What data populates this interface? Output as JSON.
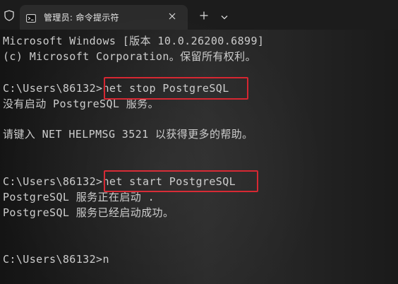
{
  "window": {
    "tab_title": "管理员: 命令提示符",
    "tab_icon": "cmd-prompt-icon",
    "shield_icon": "shield-icon",
    "close_icon": "close-icon",
    "new_tab_icon": "plus-icon",
    "dropdown_icon": "chevron-down-icon"
  },
  "colors": {
    "terminal_text": "#cccccc",
    "highlight_box": "#d6232e",
    "tab_background": "#2b2b2b",
    "titlebar_background": "#1c1c1c"
  },
  "terminal": {
    "lines": [
      "Microsoft Windows [版本 10.0.26200.6899]",
      "(c) Microsoft Corporation。保留所有权利。",
      "",
      "C:\\Users\\86132>net stop PostgreSQL",
      "没有启动 PostgreSQL 服务。",
      "",
      "请键入 NET HELPMSG 3521 以获得更多的帮助。",
      "",
      "",
      "C:\\Users\\86132>net start PostgreSQL",
      "PostgreSQL 服务正在启动 .",
      "PostgreSQL 服务已经启动成功。",
      "",
      "",
      "C:\\Users\\86132>n"
    ],
    "highlighted_commands": [
      "net stop PostgreSQL",
      "net start PostgreSQL"
    ]
  }
}
